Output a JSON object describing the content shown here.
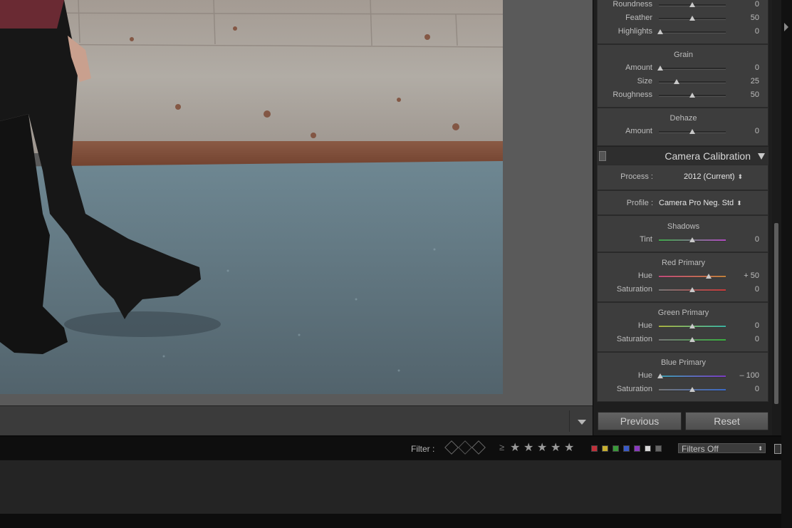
{
  "toolbar": {
    "toggle_icon": "chevron-down-icon"
  },
  "right_panel": {
    "effects_top": {
      "rows": [
        {
          "label": "Roundness",
          "value": "0",
          "pos": 0.5
        },
        {
          "label": "Feather",
          "value": "50",
          "pos": 0.5
        },
        {
          "label": "Highlights",
          "value": "0",
          "pos": 0.0
        }
      ]
    },
    "grain": {
      "title": "Grain",
      "rows": [
        {
          "label": "Amount",
          "value": "0",
          "pos": 0.0
        },
        {
          "label": "Size",
          "value": "25",
          "pos": 0.25
        },
        {
          "label": "Roughness",
          "value": "50",
          "pos": 0.5
        }
      ]
    },
    "dehaze": {
      "title": "Dehaze",
      "rows": [
        {
          "label": "Amount",
          "value": "0",
          "pos": 0.5
        }
      ]
    },
    "camera_calibration": {
      "title": "Camera Calibration",
      "process_label": "Process :",
      "process_value": "2012 (Current)",
      "profile_label": "Profile :",
      "profile_value": "Camera Pro Neg. Std",
      "shadows": {
        "title": "Shadows",
        "rows": [
          {
            "label": "Tint",
            "value": "0",
            "pos": 0.5,
            "gradient": [
              "#3fa84a",
              "#b04ac0"
            ]
          }
        ]
      },
      "red_primary": {
        "title": "Red Primary",
        "rows": [
          {
            "label": "Hue",
            "value": "+ 50",
            "pos": 0.75,
            "gradient": [
              "#c04a7a",
              "#c0803a"
            ]
          },
          {
            "label": "Saturation",
            "value": "0",
            "pos": 0.5,
            "gradient": [
              "#777777",
              "#c83a3a"
            ]
          }
        ]
      },
      "green_primary": {
        "title": "Green Primary",
        "rows": [
          {
            "label": "Hue",
            "value": "0",
            "pos": 0.5,
            "gradient": [
              "#a8b040",
              "#3ab0a0"
            ]
          },
          {
            "label": "Saturation",
            "value": "0",
            "pos": 0.5,
            "gradient": [
              "#777777",
              "#3ab040"
            ]
          }
        ]
      },
      "blue_primary": {
        "title": "Blue Primary",
        "rows": [
          {
            "label": "Hue",
            "value": "– 100",
            "pos": 0.0,
            "gradient": [
              "#3aa0b0",
              "#7a3ac0"
            ]
          },
          {
            "label": "Saturation",
            "value": "0",
            "pos": 0.5,
            "gradient": [
              "#777777",
              "#3a6ac8"
            ]
          }
        ]
      }
    },
    "previous_button": "Previous",
    "reset_button": "Reset"
  },
  "filter_bar": {
    "label": "Filter :",
    "ge_symbol": "≥",
    "stars": [
      "★",
      "★",
      "★",
      "★",
      "★"
    ],
    "color_labels": [
      "#c0303a",
      "#c8b030",
      "#3a9a3a",
      "#3a5ac8",
      "#8a3ac0",
      "#d8d8d8",
      "#666666"
    ],
    "filters_value": "Filters Off"
  }
}
